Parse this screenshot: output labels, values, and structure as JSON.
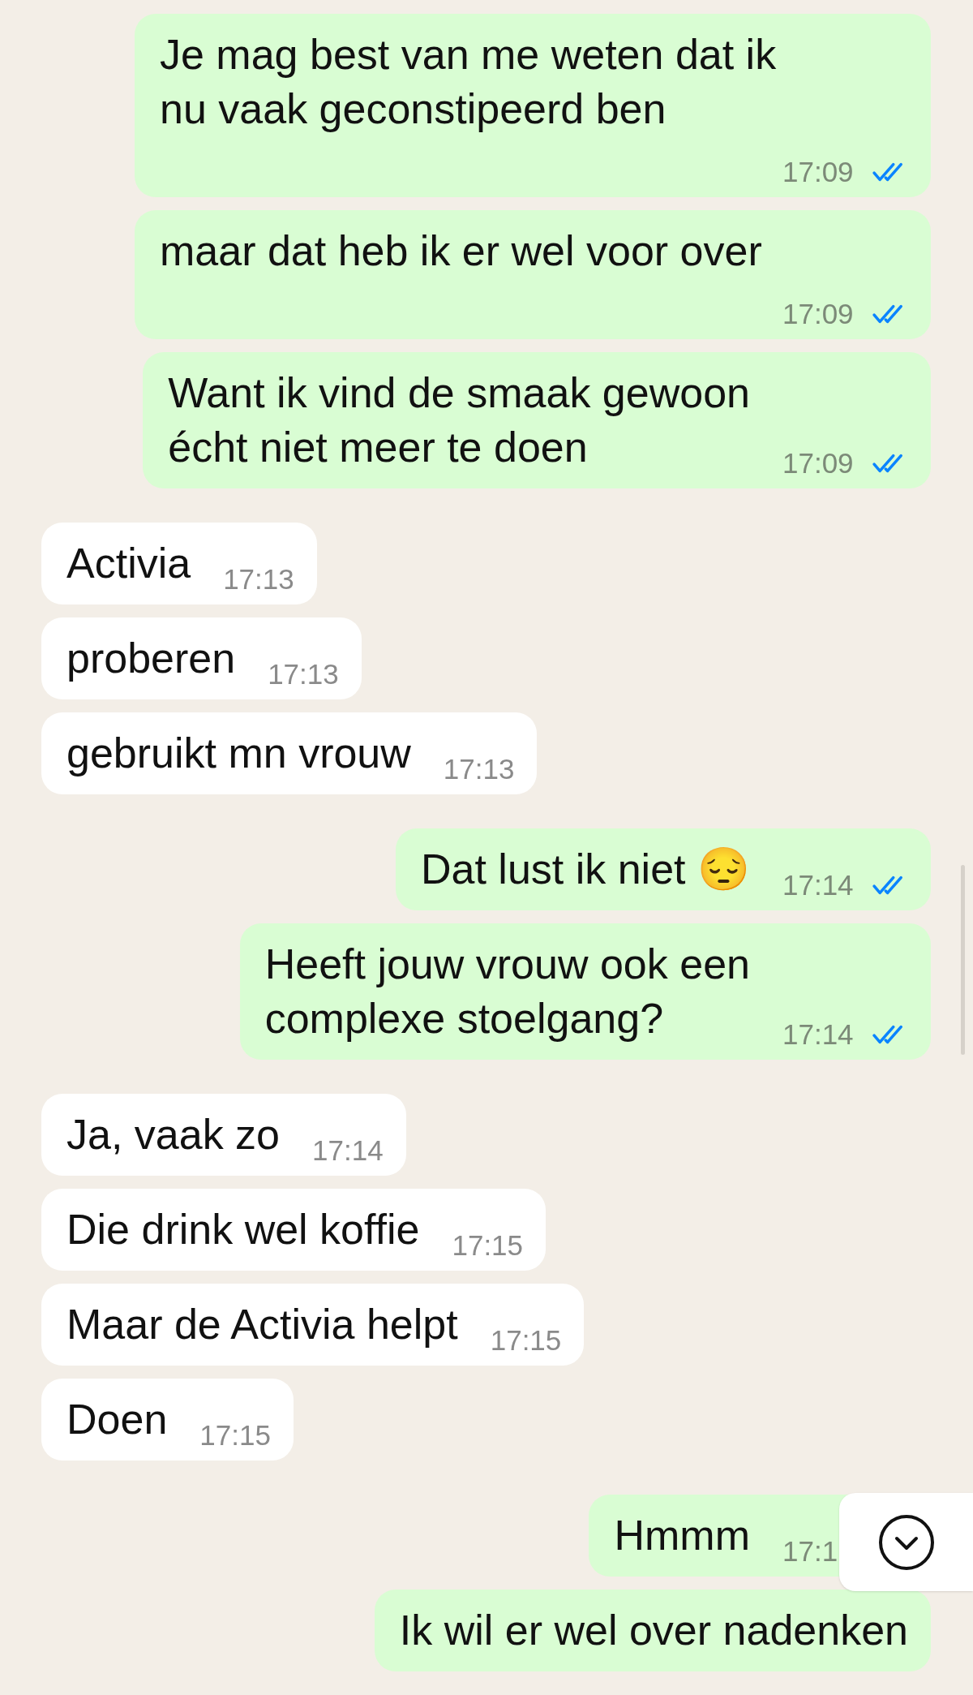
{
  "messages": [
    {
      "kind": "sent",
      "text": "Je mag best van me weten dat ik\nnu vaak geconstipeerd ben",
      "time": "17:09",
      "read": true
    },
    {
      "kind": "sent",
      "text": "maar dat heb ik er wel voor over",
      "time": "17:09",
      "read": true
    },
    {
      "kind": "sent",
      "text": "Want ik vind de smaak gewoon\nécht niet meer te doen",
      "time": "17:09",
      "read": true
    },
    {
      "kind": "received",
      "text": "Activia",
      "time": "17:13"
    },
    {
      "kind": "received",
      "text": "proberen",
      "time": "17:13"
    },
    {
      "kind": "received",
      "text": "gebruikt mn vrouw",
      "time": "17:13"
    },
    {
      "kind": "sent",
      "text": "Dat lust ik niet 😔",
      "time": "17:14",
      "read": true
    },
    {
      "kind": "sent",
      "text": "Heeft jouw vrouw ook een\ncomplexe stoelgang?",
      "time": "17:14",
      "read": true
    },
    {
      "kind": "received",
      "text": "Ja, vaak zo",
      "time": "17:14"
    },
    {
      "kind": "received",
      "text": "Die drink wel koffie",
      "time": "17:15"
    },
    {
      "kind": "received",
      "text": "Maar de Activia helpt",
      "time": "17:15"
    },
    {
      "kind": "received",
      "text": "Doen",
      "time": "17:15"
    },
    {
      "kind": "sent",
      "text": "Hmmm",
      "time": "17:1"
    },
    {
      "kind": "sent",
      "text": "Ik wil er wel over nadenken"
    }
  ]
}
